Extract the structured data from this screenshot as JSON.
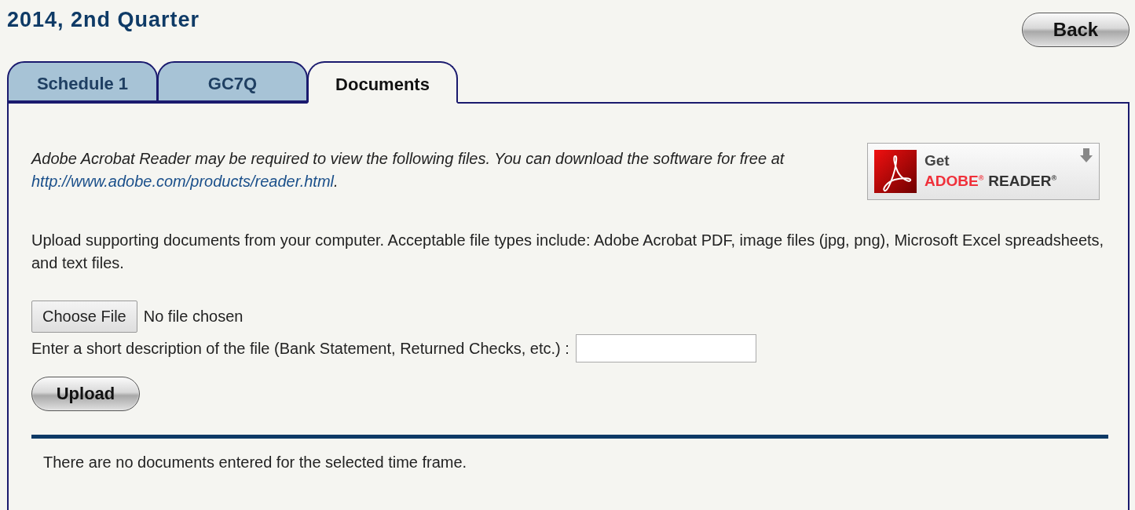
{
  "page": {
    "title": "2014, 2nd Quarter",
    "back_button": "Back"
  },
  "tabs": [
    {
      "label": "Schedule 1",
      "selected": false
    },
    {
      "label": "GC7Q",
      "selected": false
    },
    {
      "label": "Documents",
      "selected": true
    }
  ],
  "notice": {
    "text": "Adobe Acrobat Reader may be required to view the following files. You can download the software for free at",
    "link": "http://www.adobe.com/products/reader.html",
    "after_link": "."
  },
  "adobe_badge": {
    "line_1": "Get",
    "brand": "ADOBE$^{®}$",
    "product": "READER$^{®}$"
  },
  "upload_info": "Upload supporting documents from your computer. Acceptable file types include: Adobe Acrobat PDF, image files (jpg, png), Microsoft Excel spreadsheets, and text files.",
  "file_picker": {
    "button": "Choose File",
    "status": "No file chosen"
  },
  "description": {
    "label": "Enter a short description of the file (Bank Statement, Returned Checks, etc.) :"
  },
  "upload_button": "Upload",
  "empty_message": "There are no documents entered for the selected time frame."
}
